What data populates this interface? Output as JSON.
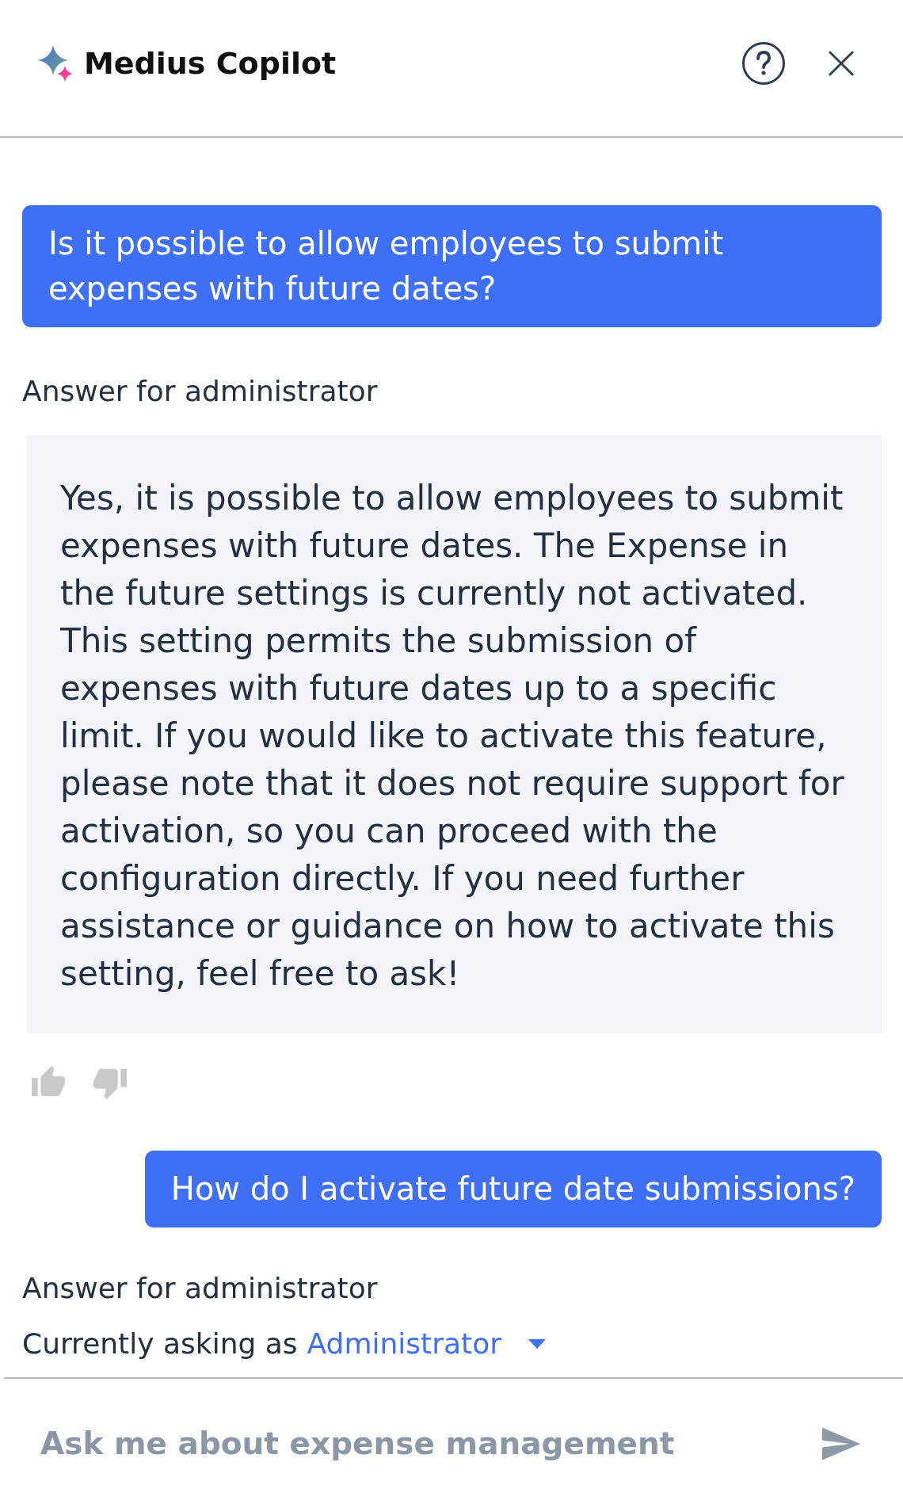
{
  "header": {
    "title": "Medius Copilot"
  },
  "messages": [
    {
      "kind": "question",
      "text": "Is it possible to allow employees to submit expenses with future dates?"
    },
    {
      "kind": "answer",
      "label": "Answer for administrator",
      "text": "Yes, it is possible to allow employees to submit expenses with future dates. The Expense in the future settings is currently not activated. This setting permits the submission of expenses with future dates up to a specific limit. If you would like to activate this feature, please note that it does not require support for activation, so you can proceed with the configuration directly. If you need further assistance or guidance on how to activate this setting, feel free to ask!",
      "feedback": [
        {
          "kind": "up",
          "selected": false
        },
        {
          "kind": "down",
          "selected": false
        }
      ]
    },
    {
      "kind": "question",
      "text": "How do I activate future date submissions?"
    },
    {
      "kind": "answer",
      "label": "Answer for administrator"
    }
  ],
  "role_selector": {
    "prefix": "Currently asking as",
    "value": "Administrator"
  },
  "composer": {
    "placeholder": "Ask me about expense management"
  }
}
